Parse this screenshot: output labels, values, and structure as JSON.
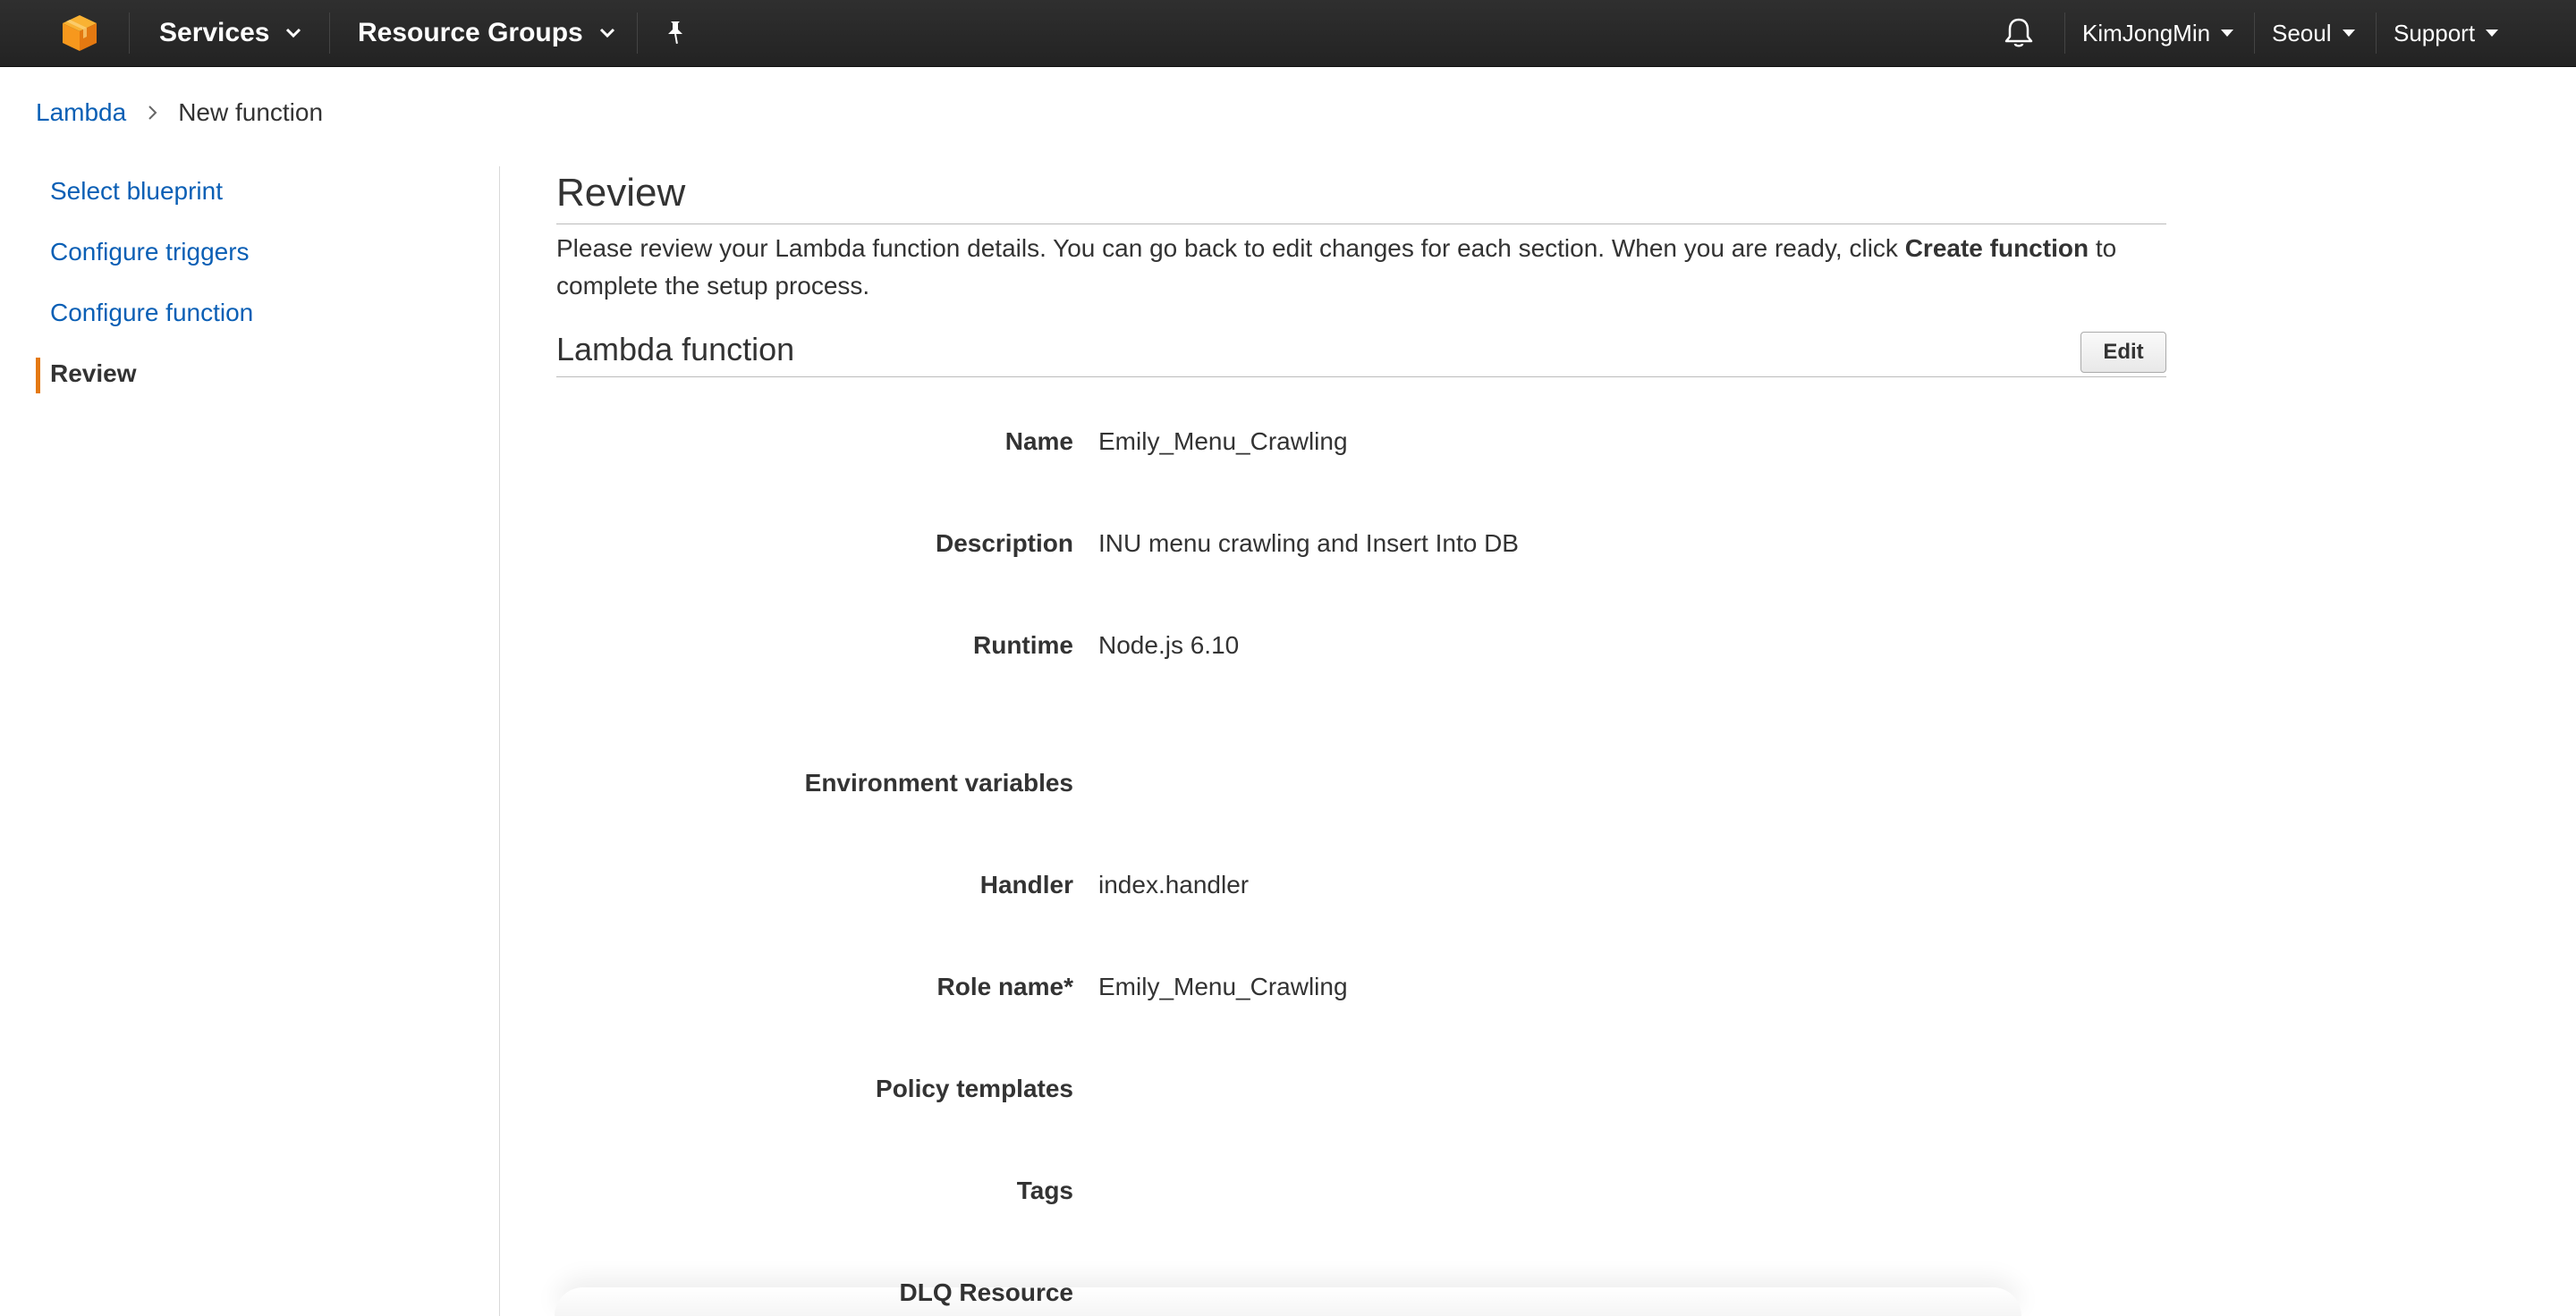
{
  "topnav": {
    "services_label": "Services",
    "resource_groups_label": "Resource Groups",
    "user_label": "KimJongMin",
    "region_label": "Seoul",
    "support_label": "Support",
    "icons": [
      "aws-cube-logo-icon",
      "chevron-down-icon",
      "pin-icon",
      "bell-icon",
      "caret-down-icon"
    ],
    "logo_color": "#f7981d"
  },
  "breadcrumb": {
    "parent": "Lambda",
    "current": "New function"
  },
  "sidebar": {
    "items": [
      {
        "label": "Select blueprint",
        "active": false
      },
      {
        "label": "Configure triggers",
        "active": false
      },
      {
        "label": "Configure function",
        "active": false
      },
      {
        "label": "Review",
        "active": true
      }
    ],
    "active_marker_color": "#e47911"
  },
  "main": {
    "title": "Review",
    "intro_before": "Please review your Lambda function details. You can go back to edit changes for each section. When you are ready, click ",
    "intro_bold": "Create function",
    "intro_after": " to complete the setup process.",
    "section_title": "Lambda function",
    "edit_label": "Edit",
    "fields": [
      {
        "label": "Name",
        "value": "Emily_Menu_Crawling"
      },
      {
        "label": "Description",
        "value": "INU menu crawling and Insert Into DB"
      },
      {
        "label": "Runtime",
        "value": "Node.js 6.10"
      },
      {
        "label": "Environment variables",
        "value": ""
      },
      {
        "label": "Handler",
        "value": "index.handler"
      },
      {
        "label": "Role name*",
        "value": "Emily_Menu_Crawling"
      },
      {
        "label": "Policy templates",
        "value": ""
      },
      {
        "label": "Tags",
        "value": ""
      },
      {
        "label": "DLQ Resource",
        "value": ""
      }
    ]
  },
  "colors": {
    "link": "#0a5fb5",
    "nav_bg": "#2a2a2a",
    "text": "#333333"
  }
}
